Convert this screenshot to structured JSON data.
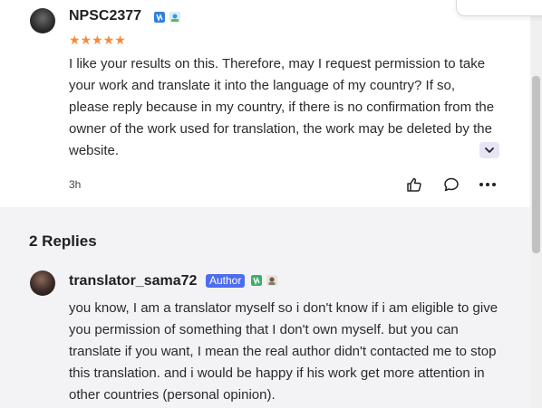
{
  "comment": {
    "username": "NPSC2377",
    "rating_stars": "★★★★★",
    "rating": 5,
    "text": " I like your results on this. Therefore, may I request permission to take your work and translate it into the language of my country? If so, please reply because in my country, if there is no confirmation from the owner of the work used for translation, the work may be deleted by the website.",
    "time": "3h"
  },
  "replies": {
    "title": "2 Replies",
    "items": [
      {
        "username": "translator_sama72",
        "badge": "Author",
        "text": " you know, I am a translator myself so i don't know if i am eligible to give you permission of something that I don't own myself. but you can translate if you want, I mean the real author didn't contacted me to stop this translation. and i would be happy if his work get more attention in other countries (personal opinion)."
      }
    ]
  },
  "icons": {
    "like": "thumbs-up-icon",
    "reply": "comment-bubble-icon",
    "more": "more-dots-icon",
    "expand": "chevron-down-icon"
  },
  "colors": {
    "star": "#f58a3c",
    "author_badge": "#4d6cf0",
    "expand_bg": "#e7e5f5",
    "replies_bg": "#f3f3f6"
  }
}
